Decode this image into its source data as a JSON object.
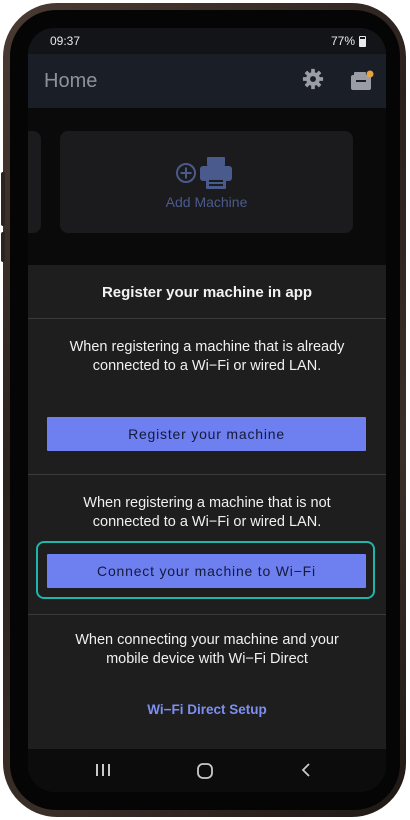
{
  "status_bar": {
    "time": "09:37",
    "battery": "77%"
  },
  "app_bar": {
    "title": "Home"
  },
  "machines": {
    "add_label": "Add Machine"
  },
  "sheet": {
    "title": "Register your machine in app",
    "register_text": "When registering a machine that is already connected to a Wi−Fi or wired LAN.",
    "register_button": "Register your machine",
    "connect_text": "When registering a machine that is not connected to a Wi−Fi or wired LAN.",
    "connect_button": "Connect your machine to Wi−Fi",
    "direct_text": "When connecting your machine and your mobile device with Wi−Fi Direct",
    "direct_link": "Wi−Fi Direct Setup"
  },
  "colors": {
    "accent": "#6e7ff0",
    "highlight": "#1fb5a9",
    "badge": "#e8a33d"
  },
  "icons": [
    "settings-icon",
    "inbox-icon",
    "add-printer-icon",
    "recent-apps-icon",
    "home-icon",
    "back-icon"
  ]
}
